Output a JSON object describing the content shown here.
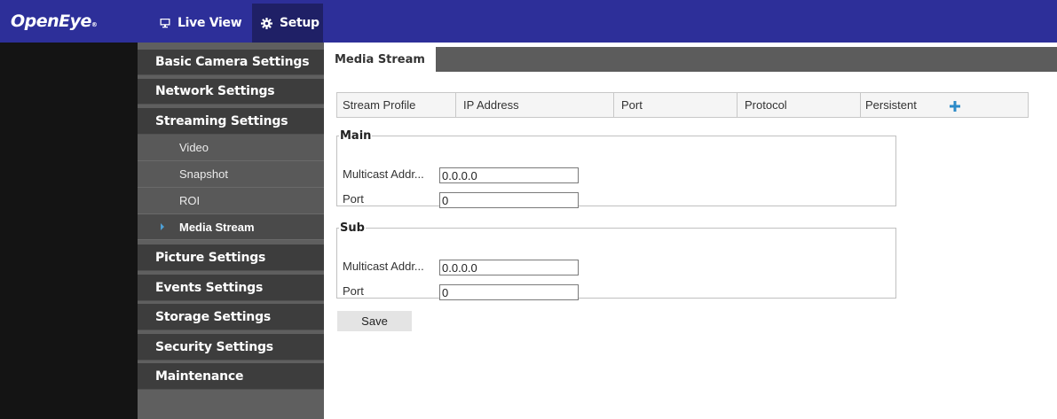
{
  "header": {
    "logo_text": "OpenEye",
    "logo_mark": "®",
    "tabs": [
      {
        "label": "Live View",
        "icon": "monitor-icon"
      },
      {
        "label": "Setup",
        "icon": "gear-icon"
      }
    ],
    "background": "#2d2f99"
  },
  "sidebar": {
    "items": [
      {
        "label": "Basic Camera Settings"
      },
      {
        "label": "Network Settings"
      },
      {
        "label": "Streaming Settings"
      },
      {
        "label": "Video"
      },
      {
        "label": "Snapshot"
      },
      {
        "label": "ROI"
      },
      {
        "label": "Media Stream"
      },
      {
        "label": "Picture Settings"
      },
      {
        "label": "Events Settings"
      },
      {
        "label": "Storage Settings"
      },
      {
        "label": "Security Settings"
      },
      {
        "label": "Maintenance"
      }
    ],
    "active_item": "Media Stream"
  },
  "main": {
    "tab_label": "Media Stream",
    "table": {
      "columns": [
        "Stream Profile",
        "IP Address",
        "Port",
        "Protocol",
        "Persistent"
      ],
      "add_icon": "plus-icon",
      "rows": []
    },
    "groups": [
      {
        "legend": "Main",
        "multicast_label": "Multicast Addr...",
        "multicast_value": "0.0.0.0",
        "port_label": "Port",
        "port_value": "0"
      },
      {
        "legend": "Sub",
        "multicast_label": "Multicast Addr...",
        "multicast_value": "0.0.0.0",
        "port_label": "Port",
        "port_value": "0"
      }
    ],
    "save_label": "Save"
  },
  "colors": {
    "header": "#2d2f99",
    "active_tab": "#1f2066",
    "sidebar_item": "#3d3d3d",
    "sidebar_sub": "#595959",
    "accent": "#2c8ac8"
  }
}
